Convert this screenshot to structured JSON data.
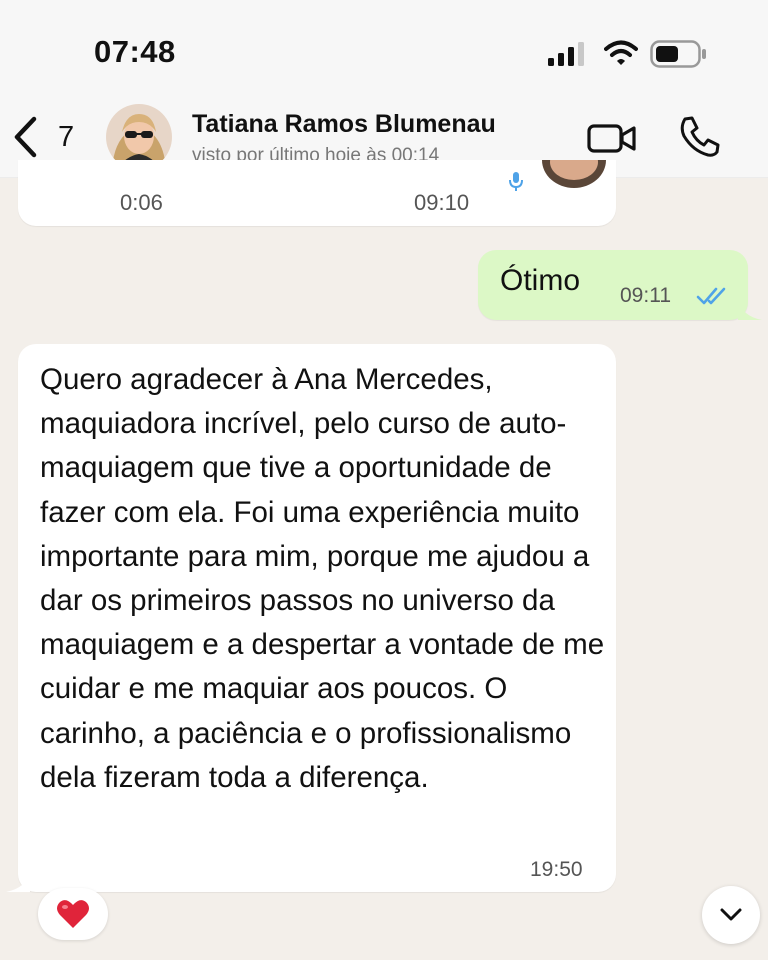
{
  "status_bar": {
    "time": "07:48",
    "icons": [
      "signal-icon",
      "wifi-icon",
      "battery-icon"
    ]
  },
  "header": {
    "back_count": "7",
    "contact_name": "Tatiana Ramos Blumenau",
    "contact_status": "visto por último hoje às 00:14",
    "icons": [
      "back-chevron-icon",
      "video-camera-icon",
      "phone-icon"
    ]
  },
  "messages": {
    "audio": {
      "duration": "0:06",
      "time": "09:10"
    },
    "outgoing": {
      "text": "Ótimo",
      "time": "09:11",
      "receipt": "read"
    },
    "incoming": {
      "text": "Quero agradecer à Ana Mercedes, maquiadora incrível, pelo curso de auto-maquiagem que tive a oportunidade de fazer com ela. Foi uma experiência muito importante para mim, porque me ajudou a dar os primeiros passos no universo da maquiagem e a despertar a vontade de me cuidar e me maquiar aos poucos. O carinho, a paciência e o profissionalismo dela fizeram toda a diferença.",
      "time": "19:50"
    }
  },
  "reaction": {
    "emoji": "red-heart-icon"
  },
  "colors": {
    "chat_background": "#f3efea",
    "outgoing_bubble": "#dcf8c6",
    "incoming_bubble": "#ffffff",
    "read_receipt": "#4fa3e8",
    "heart": "#e0243a"
  }
}
